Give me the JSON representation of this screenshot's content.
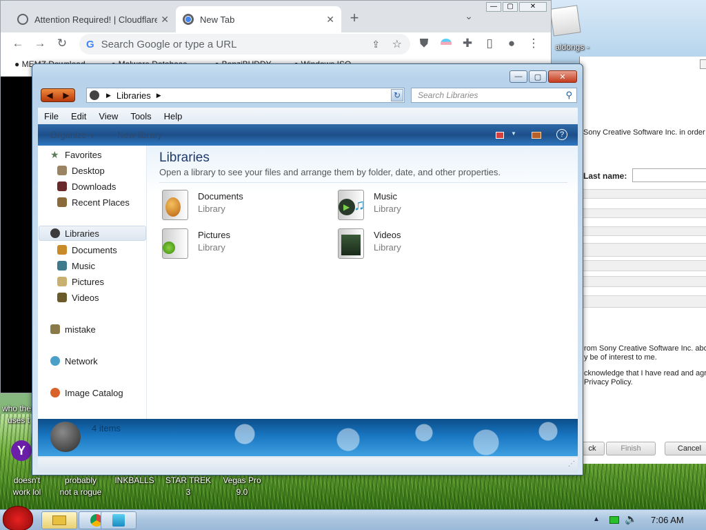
{
  "browser": {
    "tabs": [
      {
        "title": "Attention Required! | Cloudflare",
        "active": false
      },
      {
        "title": "New Tab",
        "active": true
      }
    ],
    "new_tab_label": "+",
    "omnibox_placeholder": "Search Google or type a URL",
    "bookmarks": [
      "MEMZ Download",
      "Malware Database",
      "BonziBUDDY",
      "Windows ISO"
    ],
    "desktop_shortcut_label": "aldongs -"
  },
  "explorer": {
    "address_root": "Libraries",
    "search_placeholder": "Search Libraries",
    "menu": [
      "File",
      "Edit",
      "View",
      "Tools",
      "Help"
    ],
    "commands": {
      "organize": "Organize",
      "new_library": "New library"
    },
    "nav": {
      "favorites": {
        "label": "Favorites",
        "items": [
          "Desktop",
          "Downloads",
          "Recent Places"
        ]
      },
      "libraries": {
        "label": "Libraries",
        "items": [
          "Documents",
          "Music",
          "Pictures",
          "Videos"
        ]
      },
      "mistake": "mistake",
      "network": "Network",
      "image_catalog": "Image Catalog"
    },
    "content": {
      "title": "Libraries",
      "subtitle": "Open a library to see your files and arrange them by folder, date, and other properties.",
      "libraries": [
        {
          "name": "Documents",
          "type": "Library"
        },
        {
          "name": "Music",
          "type": "Library"
        },
        {
          "name": "Pictures",
          "type": "Library"
        },
        {
          "name": "Videos",
          "type": "Library"
        }
      ]
    },
    "status": {
      "items_count": "4 items"
    }
  },
  "installer": {
    "text1": "Sony Creative Software Inc. in order",
    "last_name_label": "Last name:",
    "text2": "rom Sony Creative Software Inc. abou",
    "text3": "y be of interest to me.",
    "text4": "cknowledge that I have read and agree",
    "text5": "Privacy Policy.",
    "back_label": "ck",
    "finish_label": "Finish",
    "cancel_label": "Cancel"
  },
  "desktop": {
    "left_text": [
      "who the",
      "uses t"
    ],
    "icons": [
      {
        "line1": "doesn't",
        "line2": "work lol"
      },
      {
        "line1": "probably",
        "line2": "not a rogue"
      },
      {
        "line1": "INKBALLS",
        "line2": ""
      },
      {
        "line1": "STAR TREK",
        "line2": "3"
      },
      {
        "line1": "Vegas Pro",
        "line2": "9.0"
      }
    ]
  },
  "taskbar": {
    "clock": "7:06 AM",
    "tasks": [
      "explorer",
      "chrome",
      "app"
    ]
  },
  "colors": {
    "taskbar": "#a9c4df",
    "explorer_cmdbar": "#1d4f8a",
    "chrome_tabbar": "#dee1e6"
  }
}
